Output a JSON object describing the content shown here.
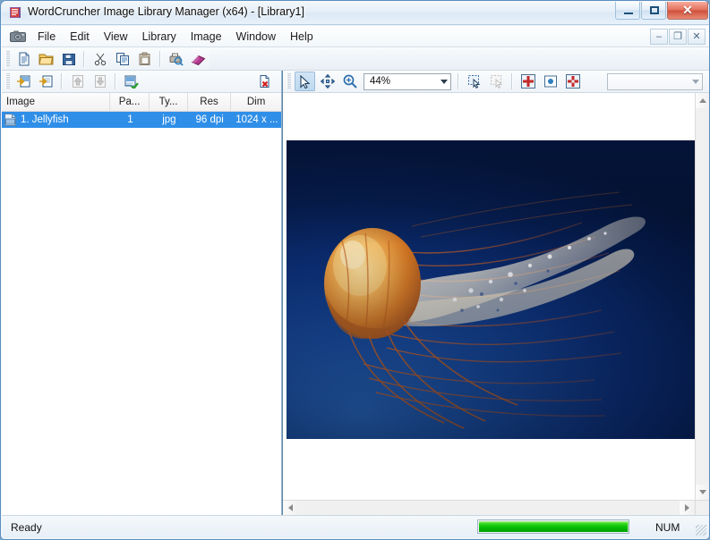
{
  "window": {
    "title": "WordCruncher Image Library Manager (x64) - [Library1]",
    "app_icon": "book-icon",
    "controls": {
      "minimize": "minimize-icon",
      "maximize": "maximize-icon",
      "close": "✕"
    }
  },
  "menubar": {
    "camera_icon": "camera-icon",
    "items": [
      {
        "label": "File"
      },
      {
        "label": "Edit"
      },
      {
        "label": "View"
      },
      {
        "label": "Library"
      },
      {
        "label": "Image"
      },
      {
        "label": "Window"
      },
      {
        "label": "Help"
      }
    ],
    "mdi_controls": {
      "minimize": "–",
      "restore": "❐",
      "close": "✕"
    }
  },
  "toolbar_main": {
    "buttons": [
      {
        "name": "new-icon",
        "title": "New"
      },
      {
        "name": "open-folder-icon",
        "title": "Open"
      },
      {
        "name": "save-floppy-icon",
        "title": "Save"
      },
      {
        "name": "cut-scissors-icon",
        "title": "Cut"
      },
      {
        "name": "copy-icon",
        "title": "Copy"
      },
      {
        "name": "paste-icon",
        "title": "Paste"
      },
      {
        "name": "print-preview-icon",
        "title": "Print Preview"
      },
      {
        "name": "book-icon",
        "title": "About"
      }
    ]
  },
  "toolbar_library": {
    "buttons": [
      {
        "name": "import-image-icon",
        "title": "Add Image"
      },
      {
        "name": "insert-image-icon",
        "title": "Insert Image"
      },
      {
        "name": "move-up-icon",
        "title": "Move Up"
      },
      {
        "name": "move-down-icon",
        "title": "Move Down"
      },
      {
        "name": "properties-icon",
        "title": "Properties"
      },
      {
        "name": "delete-image-icon",
        "title": "Delete Image"
      }
    ]
  },
  "toolbar_image": {
    "zoom_value": "44%",
    "blank_combo_value": "",
    "buttons": [
      {
        "name": "select-arrow-icon",
        "title": "Select"
      },
      {
        "name": "pan-move-icon",
        "title": "Pan"
      },
      {
        "name": "zoom-magnifier-icon",
        "title": "Zoom"
      },
      {
        "name": "region-select-icon",
        "title": "Select Region"
      },
      {
        "name": "region-apply-icon",
        "title": "Apply Region"
      },
      {
        "name": "crosshair-red-icon",
        "title": "Set Point"
      },
      {
        "name": "blue-dot-icon",
        "title": "Marker"
      },
      {
        "name": "crosshair-red-alt-icon",
        "title": "Clear Point"
      }
    ]
  },
  "library_list": {
    "columns": [
      {
        "key": "image",
        "label": "Image"
      },
      {
        "key": "pages",
        "label": "Pa..."
      },
      {
        "key": "type",
        "label": "Ty..."
      },
      {
        "key": "res",
        "label": "Res"
      },
      {
        "key": "dim",
        "label": "Dim"
      }
    ],
    "rows": [
      {
        "icon": "image-file-icon",
        "image": "1. Jellyfish",
        "pages": "1",
        "type": "jpg",
        "res": "96 dpi",
        "dim": "1024 x ...",
        "selected": true
      }
    ],
    "selection_color": "#2f8fe8"
  },
  "image_view": {
    "image_name": "Jellyfish",
    "alt": "Orange and white jellyfish on deep blue water background"
  },
  "statusbar": {
    "message": "Ready",
    "progress_percent": 100,
    "progress_color": "#06bf06",
    "num_lock": "NUM"
  }
}
